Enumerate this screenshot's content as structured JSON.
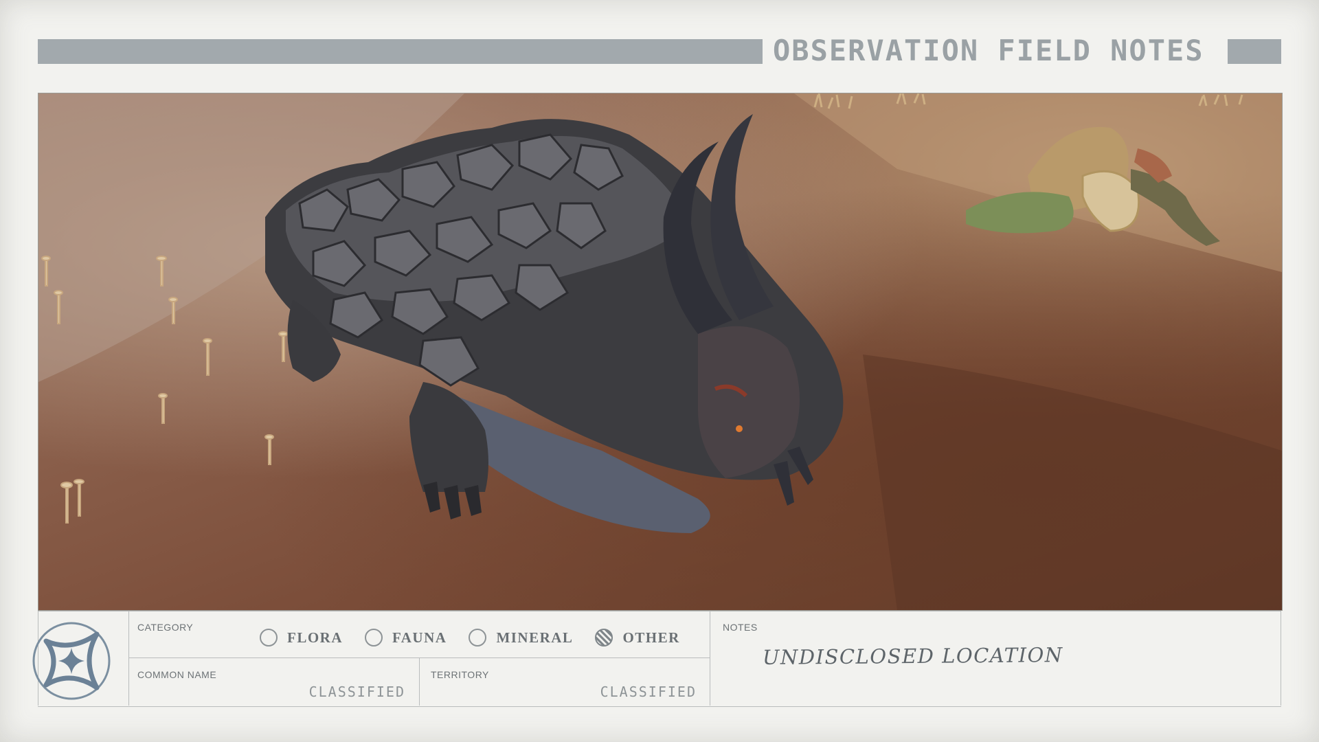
{
  "header": {
    "title": "OBSERVATION FIELD NOTES"
  },
  "photo": {
    "subject": "creature-photo"
  },
  "form": {
    "category": {
      "label": "CATEGORY",
      "options": [
        {
          "label": "FLORA",
          "selected": false
        },
        {
          "label": "FAUNA",
          "selected": false
        },
        {
          "label": "MINERAL",
          "selected": false
        },
        {
          "label": "OTHER",
          "selected": true
        }
      ]
    },
    "common_name": {
      "label": "COMMON NAME",
      "value": "CLASSIFIED"
    },
    "territory": {
      "label": "TERRITORY",
      "value": "CLASSIFIED"
    },
    "notes": {
      "label": "NOTES",
      "value": "UNDISCLOSED LOCATION"
    }
  },
  "icons": {
    "emblem": "constellation-emblem-icon"
  },
  "colors": {
    "card": "#f2f2ef",
    "header_bar": "#a2a9ad",
    "ink": "#6a7074"
  }
}
